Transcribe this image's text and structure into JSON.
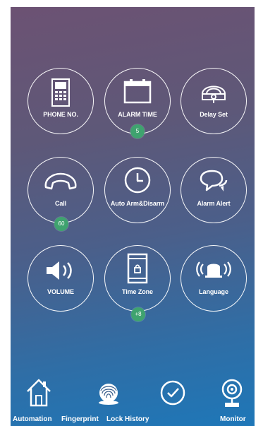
{
  "tiles": [
    {
      "label": "PHONE NO.",
      "icon": "phone-icon"
    },
    {
      "label": "ALARM TIME",
      "icon": "calendar-icon",
      "badge": "5"
    },
    {
      "label": "Delay Set",
      "icon": "lock-icon"
    },
    {
      "label": "Call",
      "icon": "handset-icon",
      "badge": "60"
    },
    {
      "label": "Auto Arm&Disarm",
      "icon": "clock-icon"
    },
    {
      "label": "Alarm Alert",
      "icon": "chat-bubbles-icon"
    },
    {
      "label": "VOLUME",
      "icon": "speaker-icon"
    },
    {
      "label": "Time Zone",
      "icon": "mobile-lock-icon",
      "badge": "+8"
    },
    {
      "label": "Language",
      "icon": "siren-icon"
    }
  ],
  "bottom_nav": {
    "labels": [
      "Automation",
      "Fingerprint",
      "Lock",
      "History",
      "Monitor"
    ],
    "icons": [
      "home-icon",
      "fingerprint-icon",
      "check-circle-icon",
      "camera-icon"
    ]
  },
  "colors": {
    "badge": "#3fa36f",
    "gradient_top": "#6c5273",
    "gradient_bottom": "#1e77b8"
  }
}
